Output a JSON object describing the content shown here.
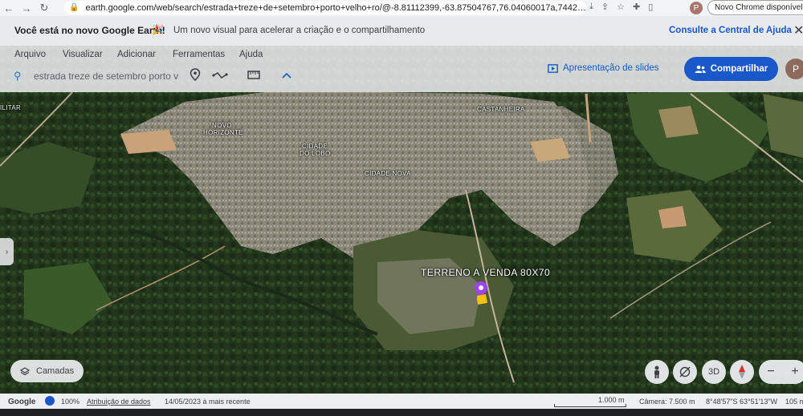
{
  "browser": {
    "url": "earth.google.com/web/search/estrada+treze+de+setembro+porto+velho+ro/@-8.81112399,-63.87504767,76.04060017a,7442.45769...",
    "update_label": "Novo Chrome disponível",
    "profile_initial": "P"
  },
  "banner": {
    "title": "Você está no novo Google Earth!",
    "emoji": "🎉",
    "text": "Um novo visual para acelerar a criação e o compartilhamento",
    "link": "Consulte a Central de Ajuda",
    "close": "✕"
  },
  "menu": {
    "items": [
      "Arquivo",
      "Visualizar",
      "Adicionar",
      "Ferramentas",
      "Ajuda"
    ]
  },
  "search": {
    "value": "estrada treze de setembro porto v"
  },
  "header": {
    "slides_label": "Apresentação de slides",
    "share_label": "Compartilhar",
    "avatar_initial": "P"
  },
  "map": {
    "labels": {
      "militar": "ILITAR",
      "novo_horizonte_1": "NOVO",
      "novo_horizonte_2": "HORIZONTE",
      "cidade_do_lobo_1": "CIDADE",
      "cidade_do_lobo_2": "DO LOBO",
      "cidade_nova": "CIDADE NOVA",
      "castanheira": "CASTANHEIRA"
    },
    "placemark": "TERRENO A VENDA 80X70"
  },
  "controls": {
    "layers_label": "Camadas",
    "three_d": "3D",
    "zoom_out": "−",
    "zoom_in": "+"
  },
  "status": {
    "brand": "Google",
    "zoom": "100%",
    "attribution": "Atribuição de dados",
    "date": "14/05/2023 à mais recente",
    "scale": "1.000 m",
    "camera": "Câmera: 7.500 m",
    "coords": "8°48'57\"S 63°51'13\"W",
    "elevation": "105 m"
  },
  "colors": {
    "accent": "#1a57c8",
    "forest": "#27391f"
  }
}
